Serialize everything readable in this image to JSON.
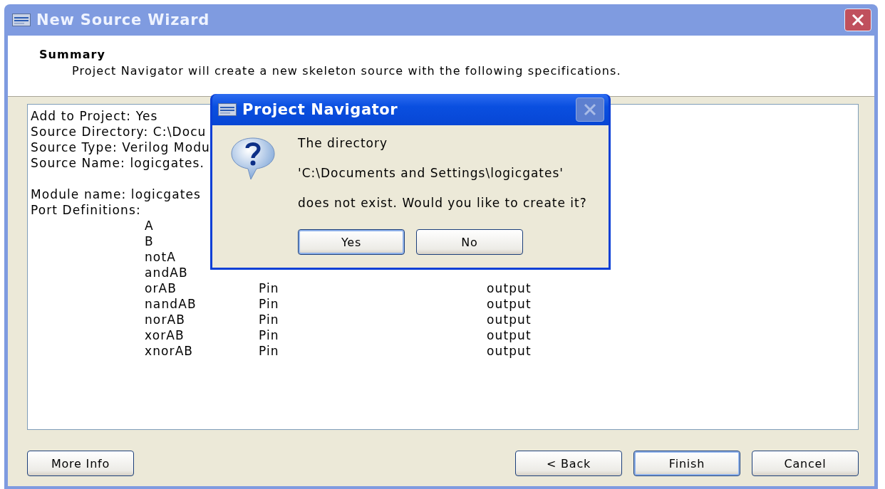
{
  "window": {
    "title": "New Source Wizard",
    "close_enabled": true
  },
  "header": {
    "title": "Summary",
    "description": "Project Navigator will create a new skeleton source with the following specifications."
  },
  "general": [
    "Add to Project: Yes",
    "Source Directory: C:\\Docu",
    "Source Type: Verilog Modu",
    "Source Name: logicgates."
  ],
  "module": [
    "Module name: logicgates",
    "Port Definitions:"
  ],
  "ports": [
    {
      "name": "A"
    },
    {
      "name": "B"
    },
    {
      "name": "notA"
    },
    {
      "name": "andAB"
    },
    {
      "name": "orAB",
      "type": "Pin",
      "direction": "output"
    },
    {
      "name": "nandAB",
      "type": "Pin",
      "direction": "output"
    },
    {
      "name": "norAB",
      "type": "Pin",
      "direction": "output"
    },
    {
      "name": "xorAB",
      "type": "Pin",
      "direction": "output"
    },
    {
      "name": "xnorAB",
      "type": "Pin",
      "direction": "output"
    }
  ],
  "buttons_left": [
    {
      "label": "More Info",
      "default": false
    }
  ],
  "buttons_right": [
    {
      "label": "< Back",
      "default": false
    },
    {
      "label": "Finish",
      "default": true
    },
    {
      "label": "Cancel",
      "default": false
    }
  ],
  "dialog": {
    "title": "Project Navigator",
    "close_enabled": false,
    "lines": [
      "The directory",
      "'C:\\Documents and Settings\\logicgates'",
      "does not exist. Would you like to create it?"
    ],
    "buttons": [
      {
        "label": "Yes",
        "default": true
      },
      {
        "label": "No",
        "default": false
      }
    ]
  }
}
